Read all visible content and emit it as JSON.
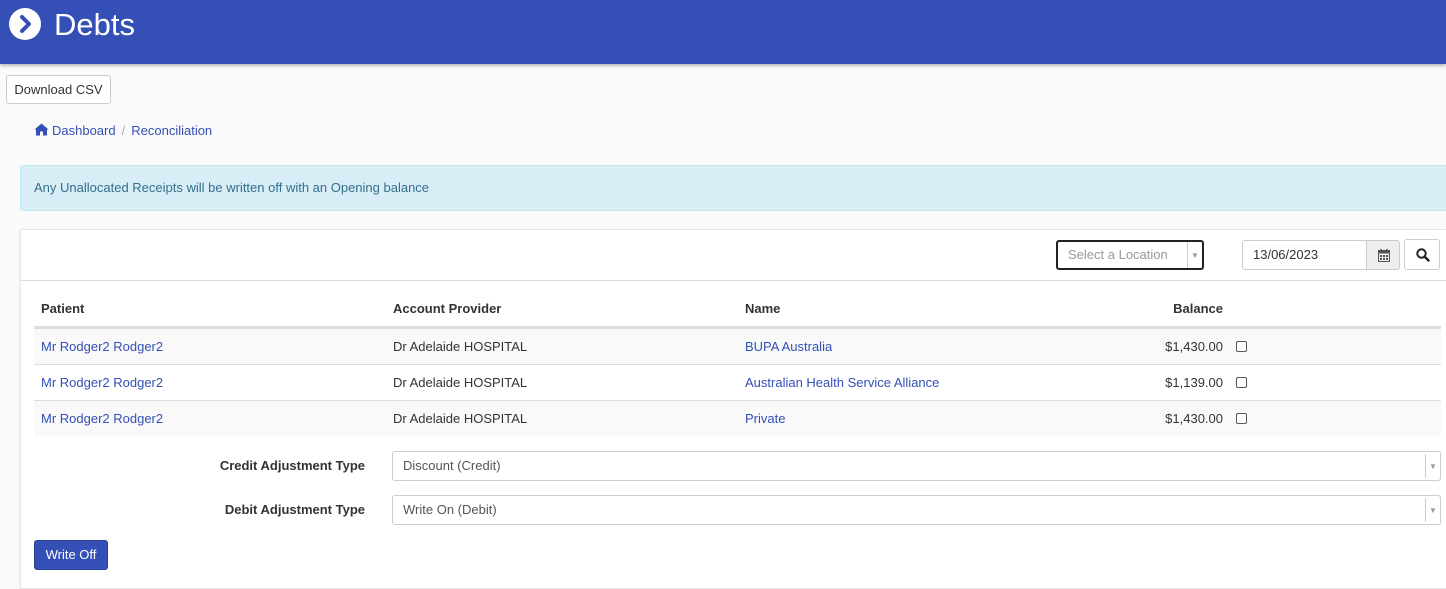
{
  "header": {
    "title": "Debts"
  },
  "toolbar": {
    "download_csv_label": "Download CSV"
  },
  "breadcrumb": {
    "home": "Dashboard",
    "current": "Reconciliation"
  },
  "alert": {
    "text": "Any Unallocated Receipts will be written off with an Opening balance"
  },
  "filters": {
    "location_placeholder": "Select a Location",
    "date_value": "13/06/2023"
  },
  "table": {
    "headers": {
      "patient": "Patient",
      "provider": "Account Provider",
      "name": "Name",
      "balance": "Balance"
    },
    "rows": [
      {
        "patient": "Mr Rodger2 Rodger2",
        "provider": "Dr Adelaide HOSPITAL",
        "name": "BUPA Australia",
        "balance": "$1,430.00"
      },
      {
        "patient": "Mr Rodger2 Rodger2",
        "provider": "Dr Adelaide HOSPITAL",
        "name": "Australian Health Service Alliance",
        "balance": "$1,139.00"
      },
      {
        "patient": "Mr Rodger2 Rodger2",
        "provider": "Dr Adelaide HOSPITAL",
        "name": "Private",
        "balance": "$1,430.00"
      }
    ]
  },
  "form": {
    "credit_label": "Credit Adjustment Type",
    "credit_value": "Discount (Credit)",
    "debit_label": "Debit Adjustment Type",
    "debit_value": "Write On (Debit)",
    "submit_label": "Write Off"
  },
  "colors": {
    "brand": "#3450b6",
    "alert_bg": "#d9edf7",
    "alert_text": "#31708f"
  },
  "icons": {
    "back": "chevron-right-circle-icon",
    "home": "home-icon",
    "calendar": "calendar-icon",
    "search": "search-icon",
    "dropdown": "caret-down-icon"
  }
}
